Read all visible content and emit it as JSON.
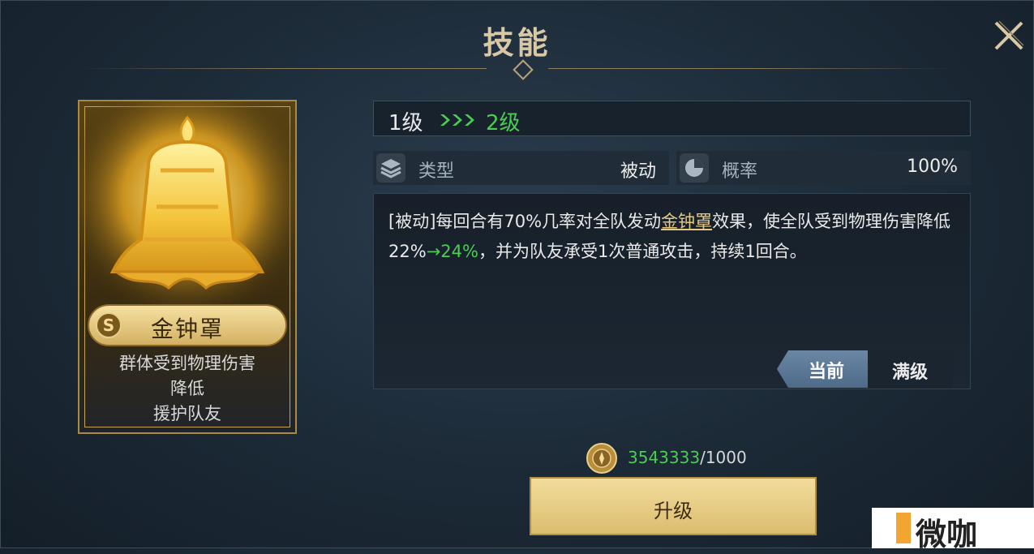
{
  "title": "技能",
  "skill_card": {
    "rank_badge": "S",
    "name": "金钟罩",
    "description_lines": [
      "群体受到物理伤害",
      "降低",
      "援护队友"
    ],
    "art_icon": "golden-bell-icon"
  },
  "level": {
    "current": "1级",
    "next": "2级",
    "arrow_icon": "triple-chevron-right-icon"
  },
  "stats": {
    "type": {
      "icon": "layers-icon",
      "label": "类型",
      "value": "被动"
    },
    "rate": {
      "icon": "pie-chart-icon",
      "label": "概率",
      "value": "100%"
    }
  },
  "description": {
    "prefix": "[被动]每回合有70%几率对全队发动",
    "skill_link": "金钟罩",
    "mid": "效果，使全队受到物理伤害降低22%",
    "upgrade_value": "→24%",
    "suffix": "，并为队友承受1次普通攻击，持续1回合。"
  },
  "tabs": {
    "current": "当前",
    "max": "满级"
  },
  "cost": {
    "icon": "coin-icon",
    "have": "3543333",
    "need": "/1000"
  },
  "upgrade_button": "升级",
  "watermark": "微咖",
  "colors": {
    "gold": "#d3b062",
    "green": "#4ccc52",
    "panel": "#1c2733"
  }
}
